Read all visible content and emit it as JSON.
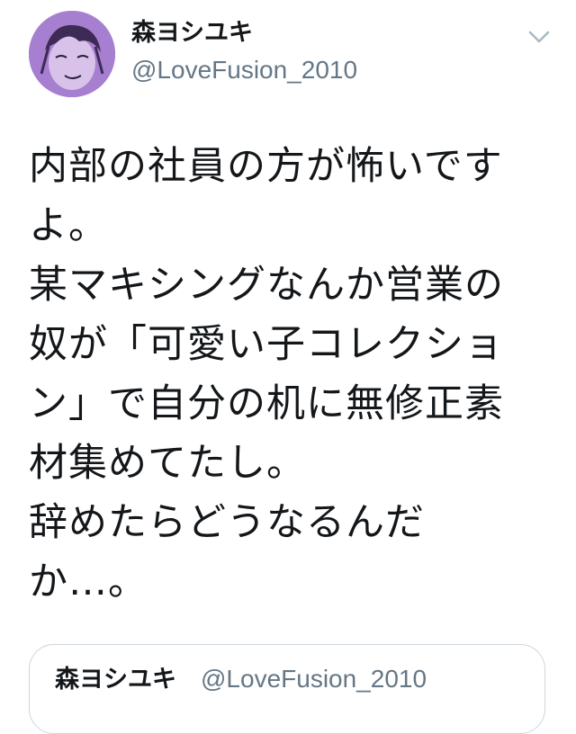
{
  "author": {
    "display_name": "森ヨシユキ",
    "handle": "@LoveFusion_2010",
    "avatar_bg": "#a77fd0"
  },
  "menu": {
    "icon": "chevron-down-icon"
  },
  "tweet": {
    "text": "内部の社員の方が怖いです\nよ。\n某マキシングなんか営業の\n奴が「可愛い子コレクショ\nン」で自分の机に無修正素\n材集めてたし。\n辞めたらどうなるんだ\nか…。"
  },
  "quoted_tweet": {
    "display_name": "森ヨシユキ",
    "handle": "@LoveFusion_2010"
  }
}
